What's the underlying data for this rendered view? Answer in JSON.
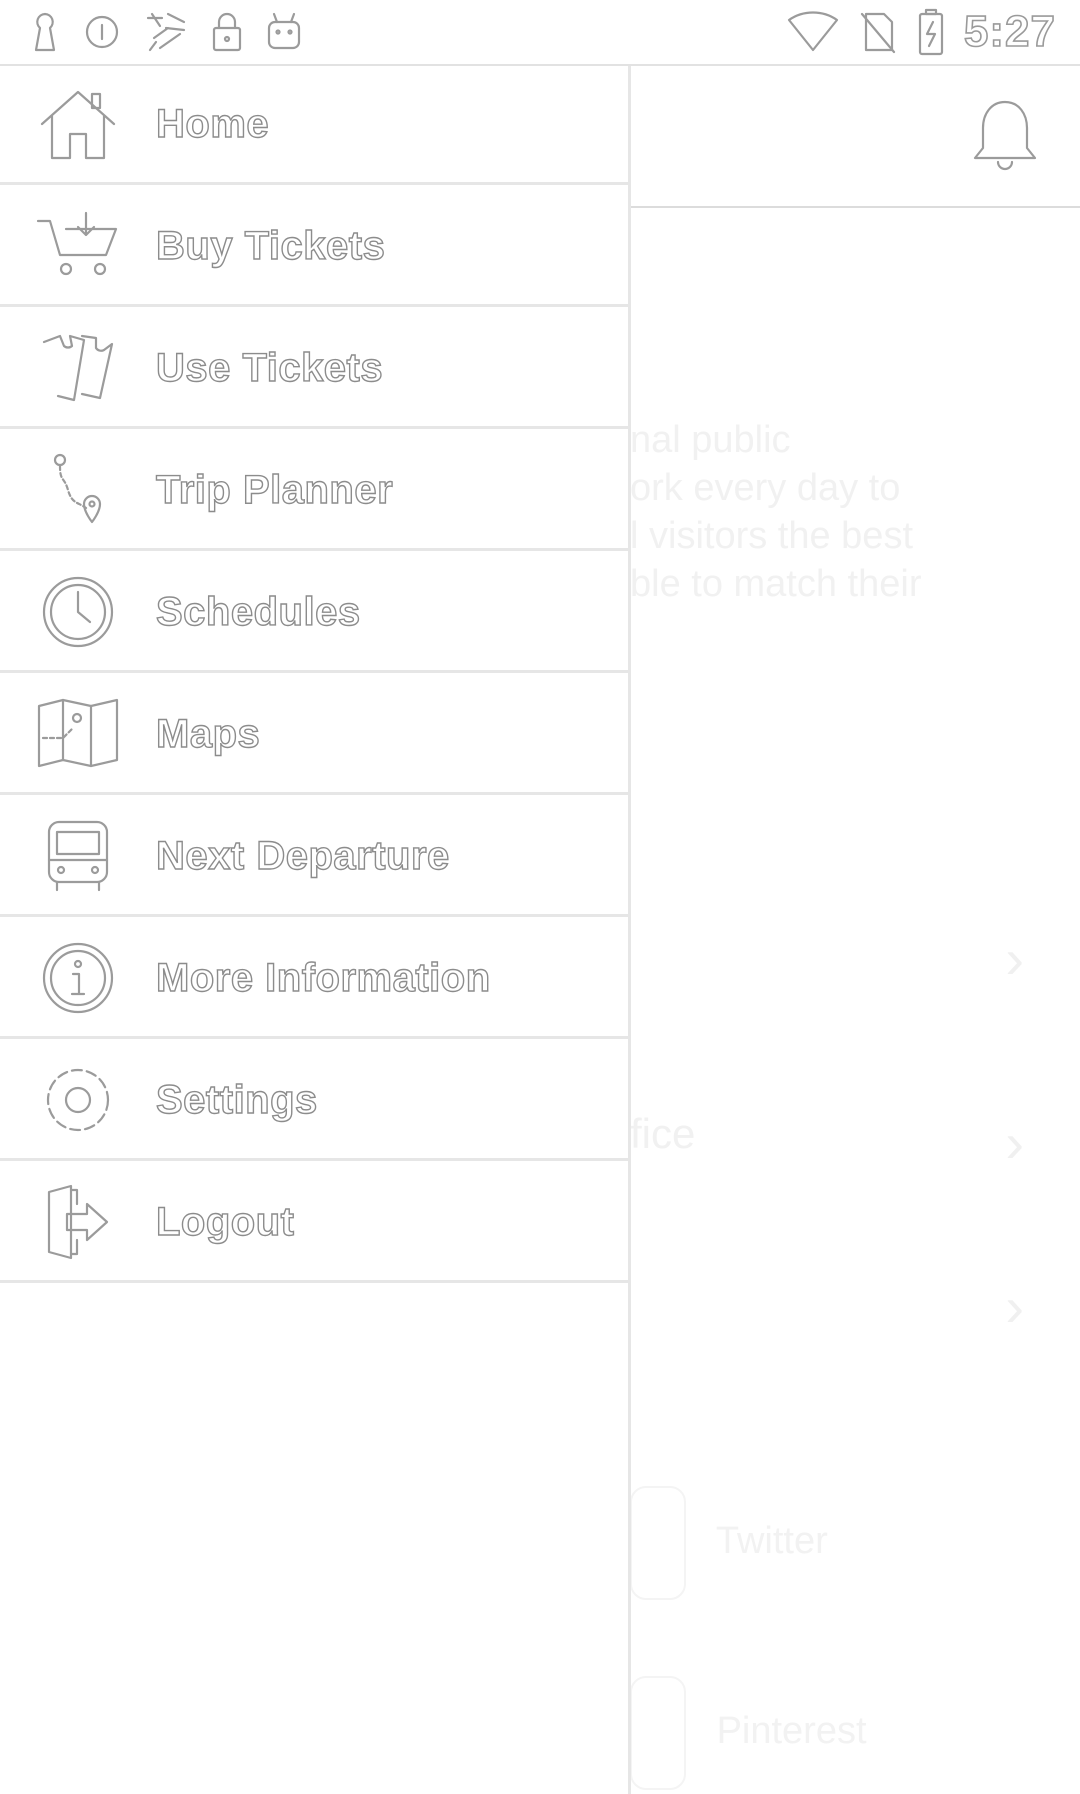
{
  "status_bar": {
    "time": "5:27",
    "left_icons": [
      "keyhole-icon",
      "info-circle-icon",
      "app-logo-icon",
      "lock-icon",
      "android-icon"
    ],
    "right_icons": [
      "wifi-icon",
      "no-sim-icon",
      "battery-charging-icon"
    ]
  },
  "drawer": {
    "items": [
      {
        "label": "Home",
        "icon": "home-icon"
      },
      {
        "label": "Buy Tickets",
        "icon": "cart-icon"
      },
      {
        "label": "Use Tickets",
        "icon": "tickets-icon"
      },
      {
        "label": "Trip Planner",
        "icon": "route-icon"
      },
      {
        "label": "Schedules",
        "icon": "clock-icon"
      },
      {
        "label": "Maps",
        "icon": "map-icon"
      },
      {
        "label": "Next Departure",
        "icon": "bus-icon"
      },
      {
        "label": "More Information",
        "icon": "info-icon"
      },
      {
        "label": "Settings",
        "icon": "gear-icon"
      },
      {
        "label": "Logout",
        "icon": "logout-icon"
      }
    ]
  },
  "background": {
    "header_icon": "bell-icon",
    "intro_lines": [
      "nal public",
      "ork every day to",
      "l visitors the best",
      "ble to match their"
    ],
    "rows": [
      "",
      "fice",
      ""
    ],
    "social": [
      "Twitter",
      "Pinterest"
    ]
  }
}
